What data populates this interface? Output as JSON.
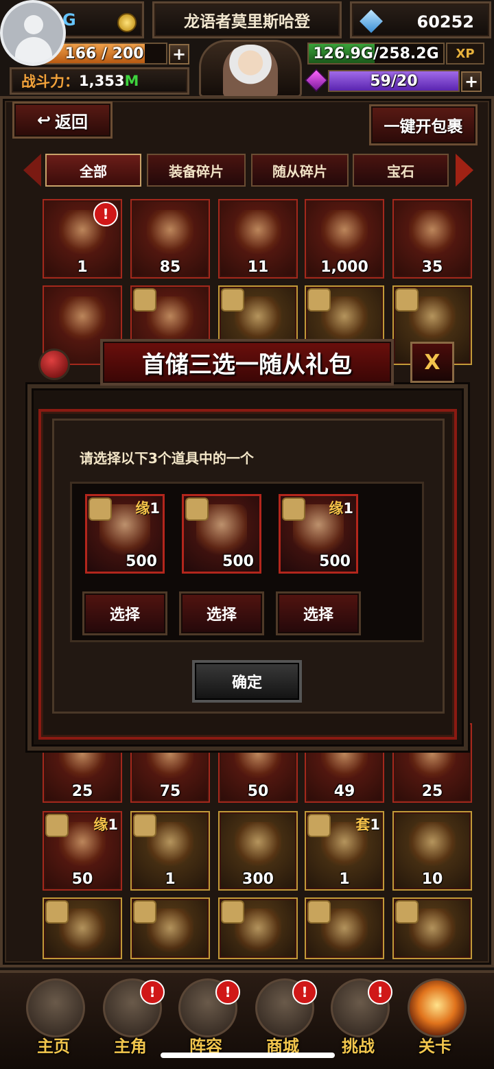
{
  "colors": {
    "accent_red": "#a4281c",
    "gold": "#f2c64d",
    "energy_orange": "#e68a2e",
    "xp_green": "#2e7d2e",
    "gem_purple": "#7b3fd1"
  },
  "hud": {
    "currency_left": "G",
    "player_name": "龙语者莫里斯哈登",
    "diamonds": "60252",
    "stamina_text": "166 / 200",
    "stamina_fraction": 0.83,
    "power_label": "战斗力：",
    "power_value": "1,353",
    "power_unit": "M",
    "xp_text": "126.9G/258.2G",
    "xp_fraction": 0.49,
    "xp_label": "XP",
    "gem_text": "59/20",
    "gem_fraction": 1.0,
    "plus": "+"
  },
  "toolbar": {
    "back_label": "返回",
    "open_all_label": "一键开包裹"
  },
  "tabs": [
    {
      "label": "全部",
      "active": true
    },
    {
      "label": "装备碎片",
      "active": false
    },
    {
      "label": "随从碎片",
      "active": false
    },
    {
      "label": "宝石",
      "active": false
    }
  ],
  "inventory_rows": [
    [
      {
        "icon": "treasure-chest-icon",
        "count": "1",
        "alert": "!"
      },
      {
        "icon": "green-potion-icon",
        "count": "85"
      },
      {
        "icon": "gold-ticket-icon",
        "count": "11"
      },
      {
        "icon": "crystal-ore-icon",
        "count": "1,000"
      },
      {
        "icon": "rune-stone-icon",
        "count": "35"
      }
    ],
    [
      {
        "icon": "green-flame-icon",
        "count": ""
      },
      {
        "icon": "demon-hero-icon",
        "count": ""
      },
      {
        "icon": "blonde-hero-icon",
        "count": ""
      },
      {
        "icon": "orc-hero-icon",
        "count": ""
      },
      {
        "icon": "hooded-hero-icon",
        "count": ""
      }
    ],
    [
      {
        "icon": "beast-hero-icon",
        "count": "25"
      },
      {
        "icon": "horned-hero-icon",
        "count": "75"
      },
      {
        "icon": "knight-hero-icon",
        "count": "50"
      },
      {
        "icon": "golden-hero-icon",
        "count": "49"
      },
      {
        "icon": "lady-hero-icon",
        "count": "25"
      }
    ],
    [
      {
        "icon": "dark-hair-hero-icon",
        "count": "50",
        "tag": "缘",
        "tag_num": "1"
      },
      {
        "icon": "sword-icon",
        "count": "1"
      },
      {
        "icon": "staff-icon",
        "count": "300"
      },
      {
        "icon": "blue-armor-icon",
        "count": "1",
        "tag": "套",
        "tag_num": "1"
      },
      {
        "icon": "gold-orb-icon",
        "count": "10"
      }
    ],
    [
      {
        "icon": "spiked-helm-icon",
        "count": ""
      },
      {
        "icon": "green-armor-icon",
        "count": ""
      },
      {
        "icon": "amber-gem-icon",
        "count": ""
      },
      {
        "icon": "purple-gem-icon",
        "count": ""
      },
      {
        "icon": "red-eye-icon",
        "count": ""
      }
    ]
  ],
  "modal": {
    "title": "首储三选一随从礼包",
    "close_label": "X",
    "prompt": "请选择以下3个道具中的一个",
    "choices": [
      {
        "icon": "golden-knight-icon",
        "count": "500",
        "tag": "缘",
        "tag_num": "1",
        "button": "选择"
      },
      {
        "icon": "horned-orc-icon",
        "count": "500",
        "tag": "",
        "tag_num": "",
        "button": "选择"
      },
      {
        "icon": "white-hair-hero-icon",
        "count": "500",
        "tag": "缘",
        "tag_num": "1",
        "button": "选择"
      }
    ],
    "confirm_label": "确定"
  },
  "nav": [
    {
      "label": "主页",
      "icon": "castle-icon",
      "alert": ""
    },
    {
      "label": "主角",
      "icon": "hero-helm-icon",
      "alert": "!"
    },
    {
      "label": "阵容",
      "icon": "golden-helm-icon",
      "alert": "!"
    },
    {
      "label": "商城",
      "icon": "treasure-icon",
      "alert": "!"
    },
    {
      "label": "挑战",
      "icon": "crossed-swords-icon",
      "alert": "!"
    },
    {
      "label": "关卡",
      "icon": "flame-level-icon",
      "alert": ""
    }
  ]
}
